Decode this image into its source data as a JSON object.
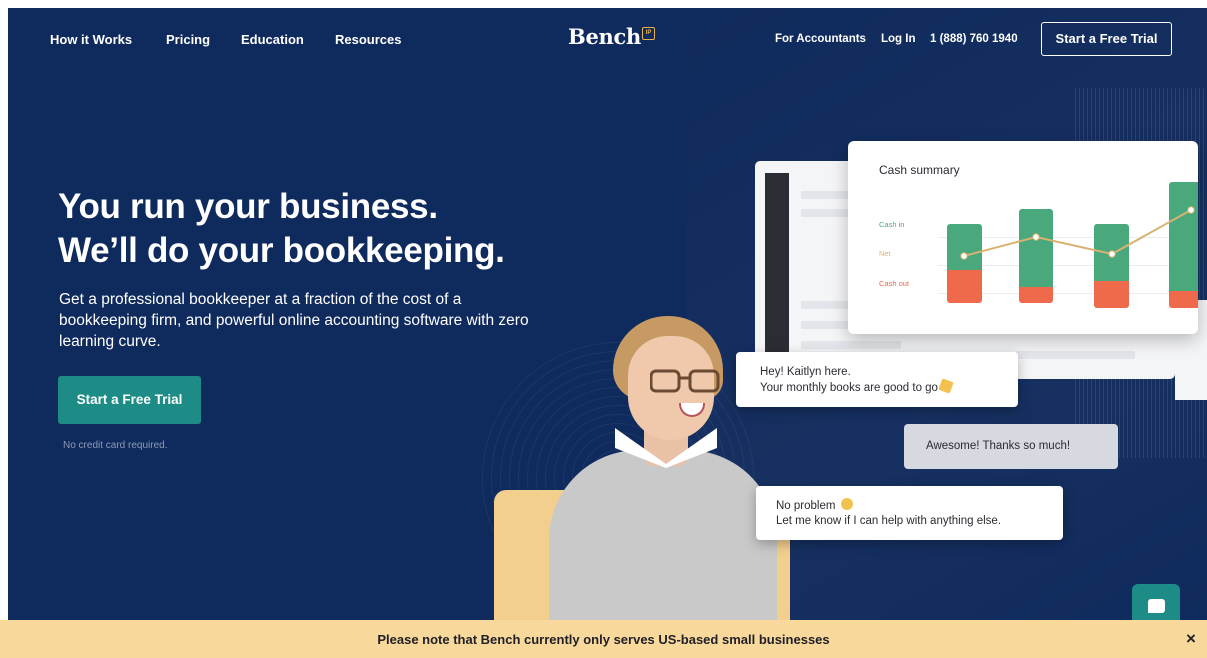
{
  "nav": {
    "links": [
      "How it Works",
      "Pricing",
      "Education",
      "Resources"
    ],
    "logo": "Bench",
    "logo_badge": "IP",
    "for_accountants": "For Accountants",
    "login": "Log In",
    "phone": "1 (888) 760 1940",
    "cta": "Start a Free Trial"
  },
  "hero": {
    "headline_line1": "You run your business.",
    "headline_line2": "We’ll do your bookkeeping.",
    "subcopy": "Get a professional bookkeeper at a fraction of the cost of a bookkeeping firm, and powerful online accounting software with zero learning curve.",
    "cta": "Start a Free Trial",
    "note": "No credit card required."
  },
  "cash_summary": {
    "title": "Cash summary",
    "labels": [
      "Cash in",
      "Net",
      "Cash out"
    ],
    "colors": {
      "cash_in": "#4aa97c",
      "net": "#e0b46a",
      "cash_out": "#ee6a4a"
    }
  },
  "chat": {
    "msg1_line1": "Hey! Kaitlyn here.",
    "msg1_line2": "Your monthly books are good to go",
    "msg2": "Awesome! Thanks so much!",
    "msg3_line1": "No problem",
    "msg3_line2": "Let me know if I can help with anything else."
  },
  "notice": {
    "text": "Please note that Bench currently only serves US-based small businesses",
    "close": "×"
  },
  "colors": {
    "hero_bg": "#0f2a5c",
    "accent": "#1e8c86",
    "notice_bg": "#f8d89b"
  }
}
